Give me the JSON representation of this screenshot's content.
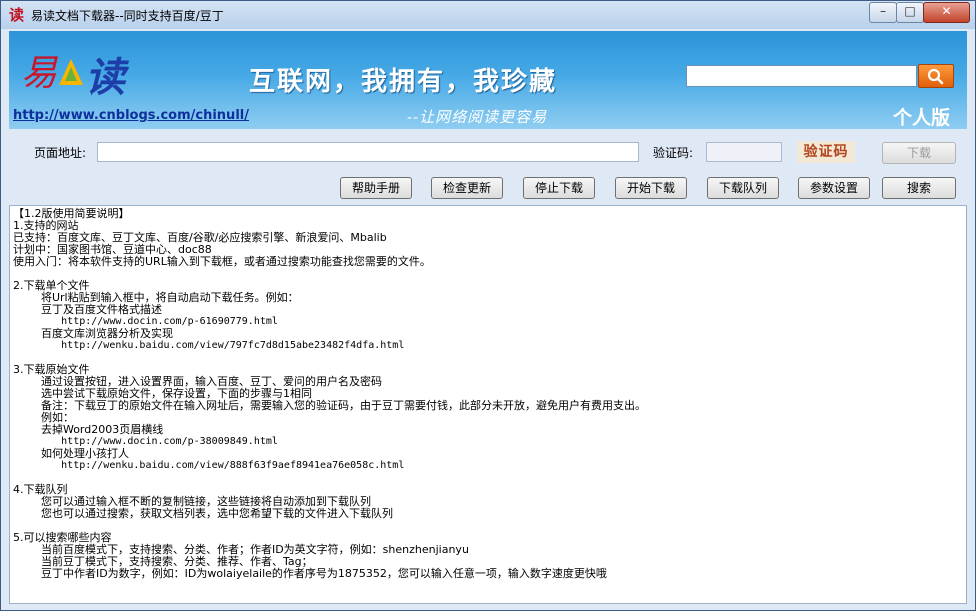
{
  "window": {
    "title": "易读文档下载器--同时支持百度/豆丁",
    "app_icon": "读",
    "min_glyph": "–",
    "max_glyph": "□",
    "close_glyph": "✕"
  },
  "banner": {
    "logo_char_1": "易",
    "logo_char_2": "读",
    "slogan": "互联网，我拥有，我珍藏",
    "subslogan": "--让网络阅读更容易",
    "url": "http://www.cnblogs.com/chinull/",
    "edition": "个人版",
    "search_value": ""
  },
  "form": {
    "url_label": "页面地址:",
    "url_value": "",
    "captcha_label": "验证码:",
    "captcha_value": "",
    "captcha_image_text": "验证码",
    "download_label": "下载"
  },
  "toolbar": {
    "help": "帮助手册",
    "check_update": "检查更新",
    "stop": "停止下载",
    "start": "开始下载",
    "queue": "下载队列",
    "settings": "参数设置",
    "search": "搜索"
  },
  "content": {
    "lines": [
      "【1.2版使用简要说明】",
      "1.支持的网站",
      "已支持：百度文库、豆丁文库、百度/谷歌/必应搜索引擎、新浪爱问、Mbalib",
      "计划中：国家图书馆、豆道中心、doc88",
      "使用入门：将本软件支持的URL输入到下载框，或者通过搜索功能查找您需要的文件。",
      "",
      "2.下载单个文件",
      "        将Url粘贴到输入框中，将自动启动下载任务。例如：",
      "        豆丁及百度文件格式描述",
      "        http://www.docin.com/p-61690779.html",
      "        百度文库浏览器分析及实现",
      "        http://wenku.baidu.com/view/797fc7d8d15abe23482f4dfa.html",
      "",
      "3.下载原始文件",
      "        通过设置按钮，进入设置界面，输入百度、豆丁、爱问的用户名及密码",
      "        选中尝试下载原始文件，保存设置，下面的步骤与1相同",
      "        备注：下载豆丁的原始文件在输入网址后，需要输入您的验证码，由于豆丁需要付钱，此部分未开放，避免用户有费用支出。",
      "        例如：",
      "        去掉Word2003页眉横线",
      "        http://www.docin.com/p-38009849.html",
      "        如何处理小孩打人",
      "        http://wenku.baidu.com/view/888f63f9aef8941ea76e058c.html",
      "",
      "4.下载队列",
      "        您可以通过输入框不断的复制链接，这些链接将自动添加到下载队列",
      "        您也可以通过搜索，获取文档列表，选中您希望下载的文件进入下载队列",
      "",
      "5.可以搜索哪些内容",
      "        当前百度模式下，支持搜索、分类、作者；作者ID为英文字符，例如：shenzhenjianyu",
      "        当前豆丁模式下，支持搜索、分类、推荐、作者、Tag；",
      "        豆丁中作者ID为数字，例如：ID为wolaiyelaile的作者序号为1875352，您可以输入任意一项，输入数字速度更快哦"
    ]
  }
}
